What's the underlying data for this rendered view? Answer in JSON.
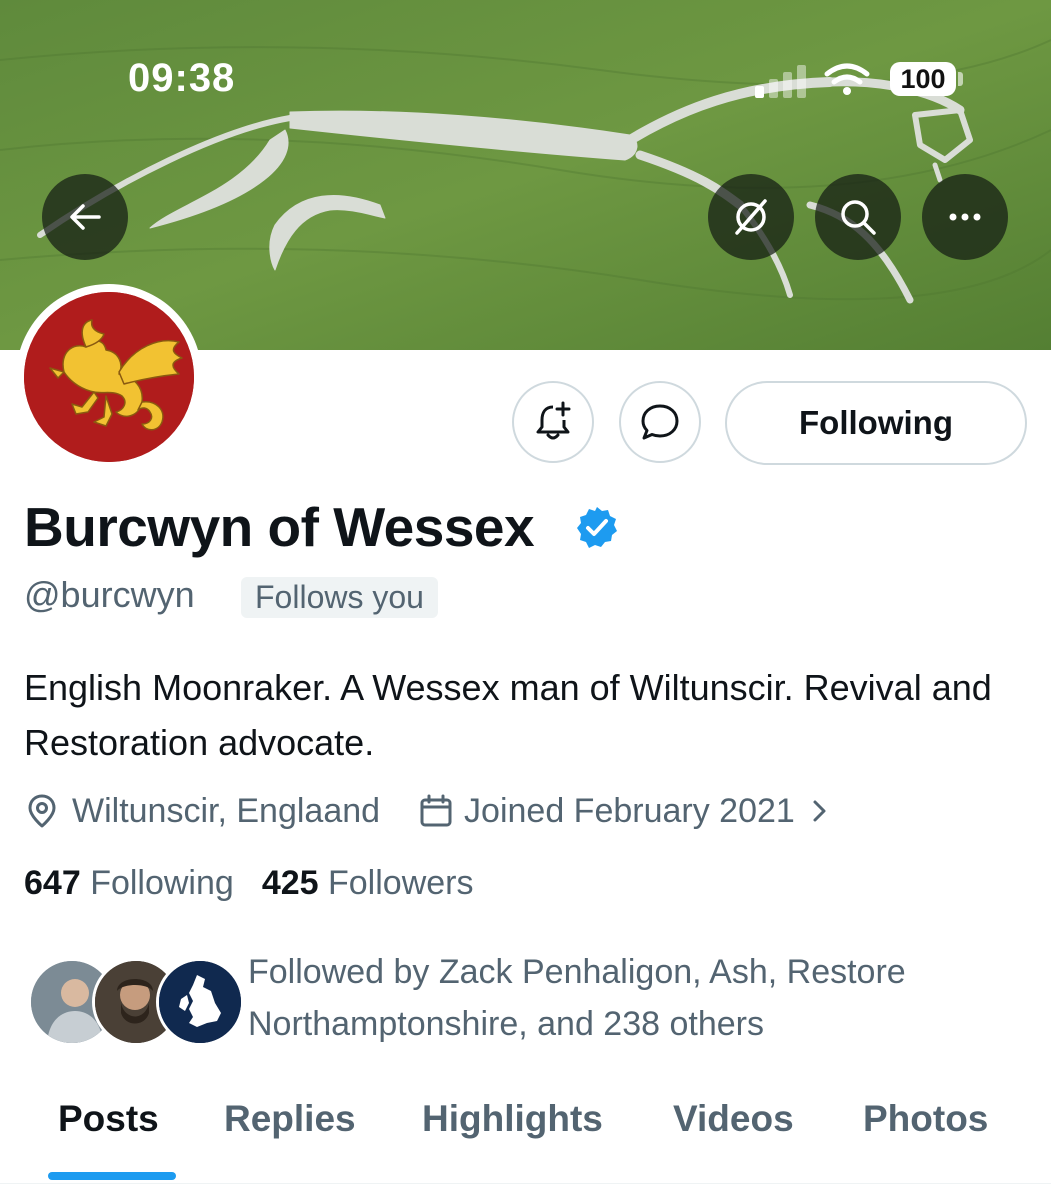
{
  "status_bar": {
    "time": "09:38",
    "battery": "100"
  },
  "profile": {
    "display_name": "Burcwyn of Wessex",
    "handle": "@burcwyn",
    "follows_you": "Follows you",
    "bio": "English Moonraker. A Wessex man of Wiltunscir. Revival and Restoration advocate.",
    "location": "Wiltunscir, Englaand",
    "joined": "Joined February 2021",
    "following_count": "647",
    "following_label": "Following",
    "followers_count": "425",
    "followers_label": "Followers",
    "followed_by": "Followed by Zack Penhaligon, Ash, Restore Northamptonshire, and 238 others"
  },
  "actions": {
    "following_button": "Following"
  },
  "tabs": [
    {
      "label": "Posts"
    },
    {
      "label": "Replies"
    },
    {
      "label": "Highlights"
    },
    {
      "label": "Videos"
    },
    {
      "label": "Photos"
    }
  ],
  "colors": {
    "accent": "#1d9bf0",
    "verified": "#1d9bf0",
    "avatar_bg": "#b01c1c",
    "dragon": "#f2c232"
  },
  "icons": [
    "back-arrow-icon",
    "grok-icon",
    "search-icon",
    "more-icon",
    "notification-add-icon",
    "message-icon",
    "verified-badge-icon",
    "location-pin-icon",
    "calendar-icon",
    "chevron-right-icon"
  ]
}
